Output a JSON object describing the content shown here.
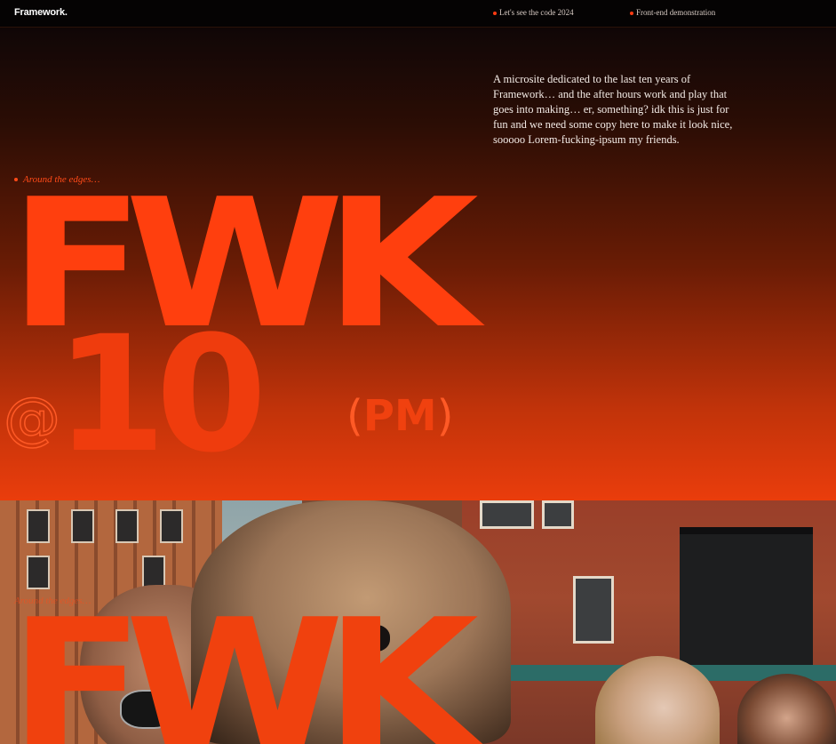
{
  "header": {
    "brand": "Framework.",
    "nav": [
      {
        "label": "Let's see the code 2024"
      },
      {
        "label": "Front-end demonstration"
      }
    ]
  },
  "intro": {
    "text": "A microsite dedicated to the last ten years of Framework… and the after hours work and play that goes into making… er, something? idk this is just for fun and we need some copy here to make it look nice, sooooo Lorem-fucking-ipsum my friends."
  },
  "hero": {
    "kicker": "Around the edges…",
    "title_word": "FWK",
    "at_symbol": "@",
    "number": "10",
    "pm_open": "(",
    "pm": "PM",
    "pm_close": ")"
  },
  "photo_section": {
    "kicker": "Around the edges…",
    "title_word": "FWK"
  },
  "colors": {
    "accent": "#ff3f0e",
    "background_top": "#060303",
    "background_bottom": "#ea3d0c",
    "text": "#f3ebe6"
  },
  "icons": [
    "bullet-dot"
  ]
}
